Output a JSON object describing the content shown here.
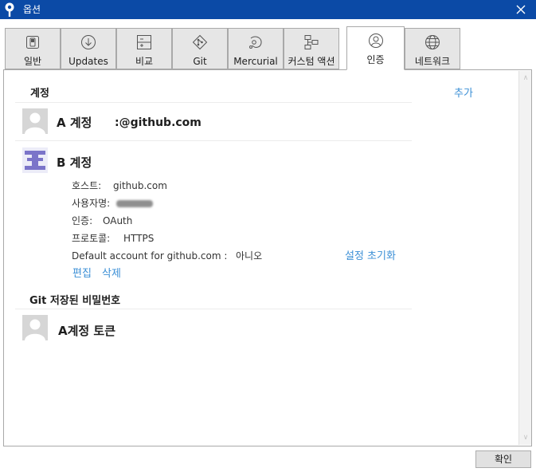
{
  "window": {
    "title": "옵션"
  },
  "tabs": [
    {
      "label": "일반",
      "icon": "toggle-switch-icon",
      "active": false
    },
    {
      "label": "Updates",
      "icon": "download-icon",
      "active": false
    },
    {
      "label": "비교",
      "icon": "diff-icon",
      "active": false
    },
    {
      "label": "Git",
      "icon": "git-diamond-icon",
      "active": false
    },
    {
      "label": "Mercurial",
      "icon": "mercurial-icon",
      "active": false
    },
    {
      "label": "커스텀 액션",
      "icon": "flowchart-icon",
      "active": false
    },
    {
      "label": "인증",
      "icon": "user-circle-icon",
      "active": true
    },
    {
      "label": "네트워크",
      "icon": "globe-icon",
      "active": false
    }
  ],
  "accounts_section": {
    "title": "계정",
    "add_label": "추가",
    "account_a": {
      "name": "A 계정",
      "email": ":@github.com"
    },
    "account_b": {
      "name": "B 계정",
      "host_label": "호스트:",
      "host_value": "github.com",
      "username_label": "사용자명:",
      "auth_label": "인증:",
      "auth_value": "OAuth",
      "protocol_label": "프로토콜:",
      "protocol_value": "HTTPS",
      "default_label": "Default account for github.com :",
      "default_value": "아니오",
      "reset_label": "설정 초기화",
      "edit_label": "편집",
      "delete_label": "삭제"
    }
  },
  "git_passwords_section": {
    "title": "Git 저장된 비밀번호",
    "entry_name": "A계정 토큰"
  },
  "footer": {
    "ok_label": "확인"
  },
  "colors": {
    "titlebar": "#0b4aa6",
    "link": "#3b8fd6",
    "identicon": "#7b74c9",
    "avatar_bg": "#d6d6d6"
  }
}
